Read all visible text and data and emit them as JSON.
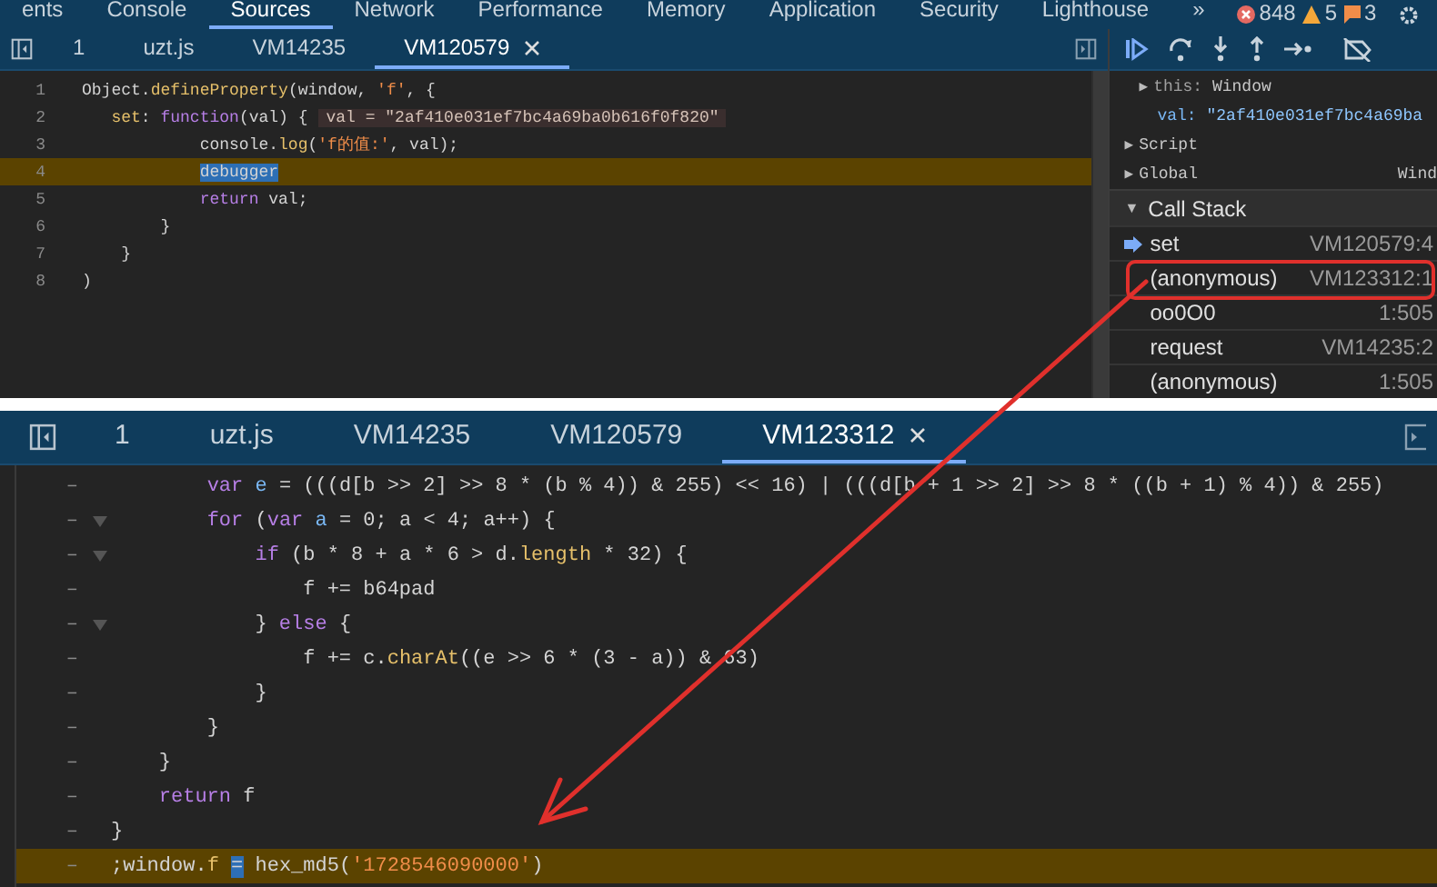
{
  "top": {
    "panel_tabs": [
      {
        "label": "ents",
        "selected": false
      },
      {
        "label": "Console",
        "selected": false
      },
      {
        "label": "Sources",
        "selected": true
      },
      {
        "label": "Network",
        "selected": false
      },
      {
        "label": "Performance",
        "selected": false
      },
      {
        "label": "Memory",
        "selected": false
      },
      {
        "label": "Application",
        "selected": false
      },
      {
        "label": "Security",
        "selected": false
      },
      {
        "label": "Lighthouse",
        "selected": false
      }
    ],
    "more": "»",
    "errors": "848",
    "warnings": "5",
    "infos": "3",
    "file_tabs": [
      {
        "label": "1",
        "selected": false
      },
      {
        "label": "uzt.js",
        "selected": false
      },
      {
        "label": "VM14235",
        "selected": false
      },
      {
        "label": "VM120579",
        "selected": true
      }
    ],
    "lines": [
      {
        "number": "1",
        "highlighted": false,
        "tokens": [
          {
            "text": "Object.",
            "kind": "plain"
          },
          {
            "text": "defineProperty",
            "kind": "func"
          },
          {
            "text": "(window, ",
            "kind": "plain"
          },
          {
            "text": "'f'",
            "kind": "string"
          },
          {
            "text": ", {",
            "kind": "plain"
          }
        ]
      },
      {
        "number": "2",
        "highlighted": false,
        "inline_value": "val = \"2af410e031ef7bc4a69ba0b616f0f820\"",
        "tokens": [
          {
            "text": "   set",
            "kind": "func"
          },
          {
            "text": ": ",
            "kind": "plain"
          },
          {
            "text": "function",
            "kind": "keyword"
          },
          {
            "text": "(val) {",
            "kind": "plain"
          }
        ]
      },
      {
        "number": "3",
        "highlighted": false,
        "tokens": [
          {
            "text": "            console.",
            "kind": "plain"
          },
          {
            "text": "log",
            "kind": "func"
          },
          {
            "text": "(",
            "kind": "plain"
          },
          {
            "text": "'f的值:'",
            "kind": "string"
          },
          {
            "text": ", val);",
            "kind": "plain"
          }
        ]
      },
      {
        "number": "4",
        "highlighted": true,
        "tokens": [
          {
            "text": "            debugger",
            "kind": "selection"
          }
        ]
      },
      {
        "number": "5",
        "highlighted": false,
        "tokens": [
          {
            "text": "            return",
            "kind": "keyword"
          },
          {
            "text": " val;",
            "kind": "plain"
          }
        ]
      },
      {
        "number": "6",
        "highlighted": false,
        "tokens": [
          {
            "text": "        }",
            "kind": "plain"
          }
        ]
      },
      {
        "number": "7",
        "highlighted": false,
        "tokens": [
          {
            "text": "    }",
            "kind": "plain"
          }
        ]
      },
      {
        "number": "8",
        "highlighted": false,
        "tokens": [
          {
            "text": ")",
            "kind": "plain"
          }
        ]
      }
    ],
    "scope": [
      {
        "kind": "object",
        "toggle": "▶",
        "name": "this:",
        "value": "Window"
      },
      {
        "kind": "property",
        "name": "val:",
        "value": "\"2af410e031ef7bc4a69ba"
      },
      {
        "kind": "section",
        "toggle": "▶",
        "name": "Script"
      },
      {
        "kind": "section",
        "toggle": "▶",
        "name": "Global",
        "value": "Wind"
      }
    ],
    "call_stack_toggle": "▼",
    "call_stack_title": "Call Stack",
    "call_stack": [
      {
        "name": "set",
        "location": "VM120579:4",
        "current": true
      },
      {
        "name": "(anonymous)",
        "location": "VM123312:1",
        "current": false
      },
      {
        "name": "oo0O0",
        "location": "1:505",
        "current": false
      },
      {
        "name": "request",
        "location": "VM14235:2",
        "current": false
      },
      {
        "name": "(anonymous)",
        "location": "1:505",
        "current": false
      }
    ]
  },
  "bottom": {
    "file_tabs": [
      {
        "label": "1",
        "selected": false
      },
      {
        "label": "uzt.js",
        "selected": false
      },
      {
        "label": "VM14235",
        "selected": false
      },
      {
        "label": "VM120579",
        "selected": false
      },
      {
        "label": "VM123312",
        "selected": true
      }
    ],
    "lines": [
      {
        "number": "–",
        "foldable": false,
        "highlighted": false,
        "tokens": [
          {
            "text": "        var",
            "kind": "keyword"
          },
          {
            "text": " e",
            "kind": "var"
          },
          {
            "text": " = (((d[b >> 2] >> 8 * (b % 4)) & 255) << 16) | (((d[b + 1 >> 2] >> 8 * ((b + 1) % 4)) & 255)",
            "kind": "plain"
          }
        ]
      },
      {
        "number": "–",
        "foldable": true,
        "highlighted": false,
        "tokens": [
          {
            "text": "        for",
            "kind": "keyword"
          },
          {
            "text": " (",
            "kind": "plain"
          },
          {
            "text": "var",
            "kind": "keyword"
          },
          {
            "text": " a",
            "kind": "var"
          },
          {
            "text": " = 0; a < 4; a++) {",
            "kind": "plain"
          }
        ]
      },
      {
        "number": "–",
        "foldable": true,
        "highlighted": false,
        "tokens": [
          {
            "text": "            if",
            "kind": "keyword"
          },
          {
            "text": " (b * 8 + a * 6 > d.",
            "kind": "plain"
          },
          {
            "text": "length",
            "kind": "func"
          },
          {
            "text": " * 32) {",
            "kind": "plain"
          }
        ]
      },
      {
        "number": "–",
        "foldable": false,
        "highlighted": false,
        "tokens": [
          {
            "text": "                f += b64pad",
            "kind": "plain"
          }
        ]
      },
      {
        "number": "–",
        "foldable": true,
        "highlighted": false,
        "tokens": [
          {
            "text": "            } ",
            "kind": "plain"
          },
          {
            "text": "else",
            "kind": "keyword"
          },
          {
            "text": " {",
            "kind": "plain"
          }
        ]
      },
      {
        "number": "–",
        "foldable": false,
        "highlighted": false,
        "tokens": [
          {
            "text": "                f += c.",
            "kind": "plain"
          },
          {
            "text": "charAt",
            "kind": "func"
          },
          {
            "text": "((e >> 6 * (3 - a)) & 63)",
            "kind": "plain"
          }
        ]
      },
      {
        "number": "–",
        "foldable": false,
        "highlighted": false,
        "tokens": [
          {
            "text": "            }",
            "kind": "plain"
          }
        ]
      },
      {
        "number": "–",
        "foldable": false,
        "highlighted": false,
        "tokens": [
          {
            "text": "        }",
            "kind": "plain"
          }
        ]
      },
      {
        "number": "–",
        "foldable": false,
        "highlighted": false,
        "tokens": [
          {
            "text": "    }",
            "kind": "plain"
          }
        ]
      },
      {
        "number": "–",
        "foldable": false,
        "highlighted": false,
        "tokens": [
          {
            "text": "    return",
            "kind": "keyword"
          },
          {
            "text": " f",
            "kind": "plain"
          }
        ]
      },
      {
        "number": "–",
        "foldable": false,
        "highlighted": false,
        "tokens": [
          {
            "text": "}",
            "kind": "plain"
          }
        ]
      },
      {
        "number": "–",
        "foldable": false,
        "highlighted": true,
        "tokens": [
          {
            "text": ";window.",
            "kind": "plain"
          },
          {
            "text": "f",
            "kind": "func"
          },
          {
            "text": " =",
            "kind": "selection"
          },
          {
            "text": " hex_md5(",
            "kind": "plain"
          },
          {
            "text": "'1728546090000'",
            "kind": "string"
          },
          {
            "text": ")",
            "kind": "plain"
          }
        ]
      }
    ]
  }
}
